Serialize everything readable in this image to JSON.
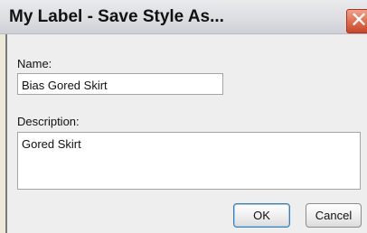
{
  "window": {
    "title": "My Label - Save Style As...",
    "close_icon": "close-icon"
  },
  "form": {
    "name_label": "Name:",
    "name_value": "Bias Gored Skirt",
    "description_label": "Description:",
    "description_value": "Gored Skirt"
  },
  "buttons": {
    "ok_label": "OK",
    "cancel_label": "Cancel"
  },
  "colors": {
    "close_button": "#e06b4a",
    "default_button_border": "#3c7fb1"
  }
}
